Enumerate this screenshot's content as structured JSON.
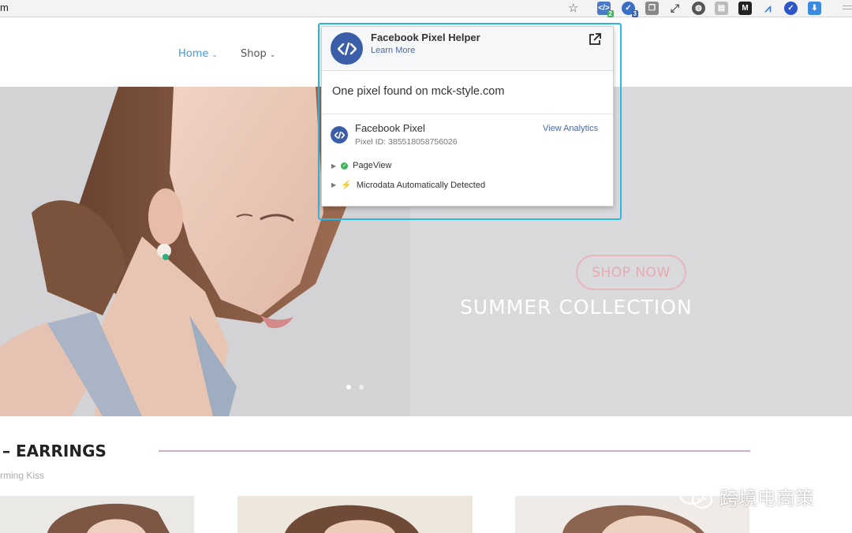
{
  "browser": {
    "url_fragment": "m",
    "extensions": [
      {
        "name": "pixel-helper",
        "badge": "2",
        "color": "#4a7ac8",
        "badge_color": "#3fb35a"
      },
      {
        "name": "tag-assistant",
        "badge": "3",
        "color": "#3b6fc4",
        "badge_color": "#3b5ea8"
      },
      {
        "name": "copy",
        "color": "#777"
      },
      {
        "name": "fullscreen",
        "color": "#666"
      },
      {
        "name": "globe",
        "color": "#555"
      },
      {
        "name": "pin",
        "color": "#aaa"
      },
      {
        "name": "m-ext",
        "color": "#222"
      },
      {
        "name": "wave",
        "color": "#2b7ad0"
      },
      {
        "name": "check-shield",
        "color": "#2b55c8"
      },
      {
        "name": "download",
        "color": "#3d8be0"
      }
    ]
  },
  "nav": {
    "home": "Home",
    "shop": "Shop"
  },
  "hero": {
    "title": "SUMMER COLLECTION",
    "button": "SHOP NOW"
  },
  "section": {
    "title": "– EARRINGS",
    "subtitle": "rming Kiss"
  },
  "popup": {
    "title": "Facebook Pixel Helper",
    "learn_more": "Learn More",
    "found_text": "One pixel found on mck-style.com",
    "pixel_name": "Facebook Pixel",
    "pixel_id": "Pixel ID: 385518058756026",
    "view_analytics": "View Analytics",
    "events": [
      {
        "label": "PageView",
        "status": "ok"
      },
      {
        "label": "Microdata Automatically Detected",
        "status": "info"
      }
    ]
  },
  "watermark": {
    "text": "跨境电商策"
  },
  "colors": {
    "accent": "#3d9be0",
    "facebook": "#3b5ea8",
    "highlight": "#29b8e8",
    "shop_now": "#e8a9b1"
  }
}
